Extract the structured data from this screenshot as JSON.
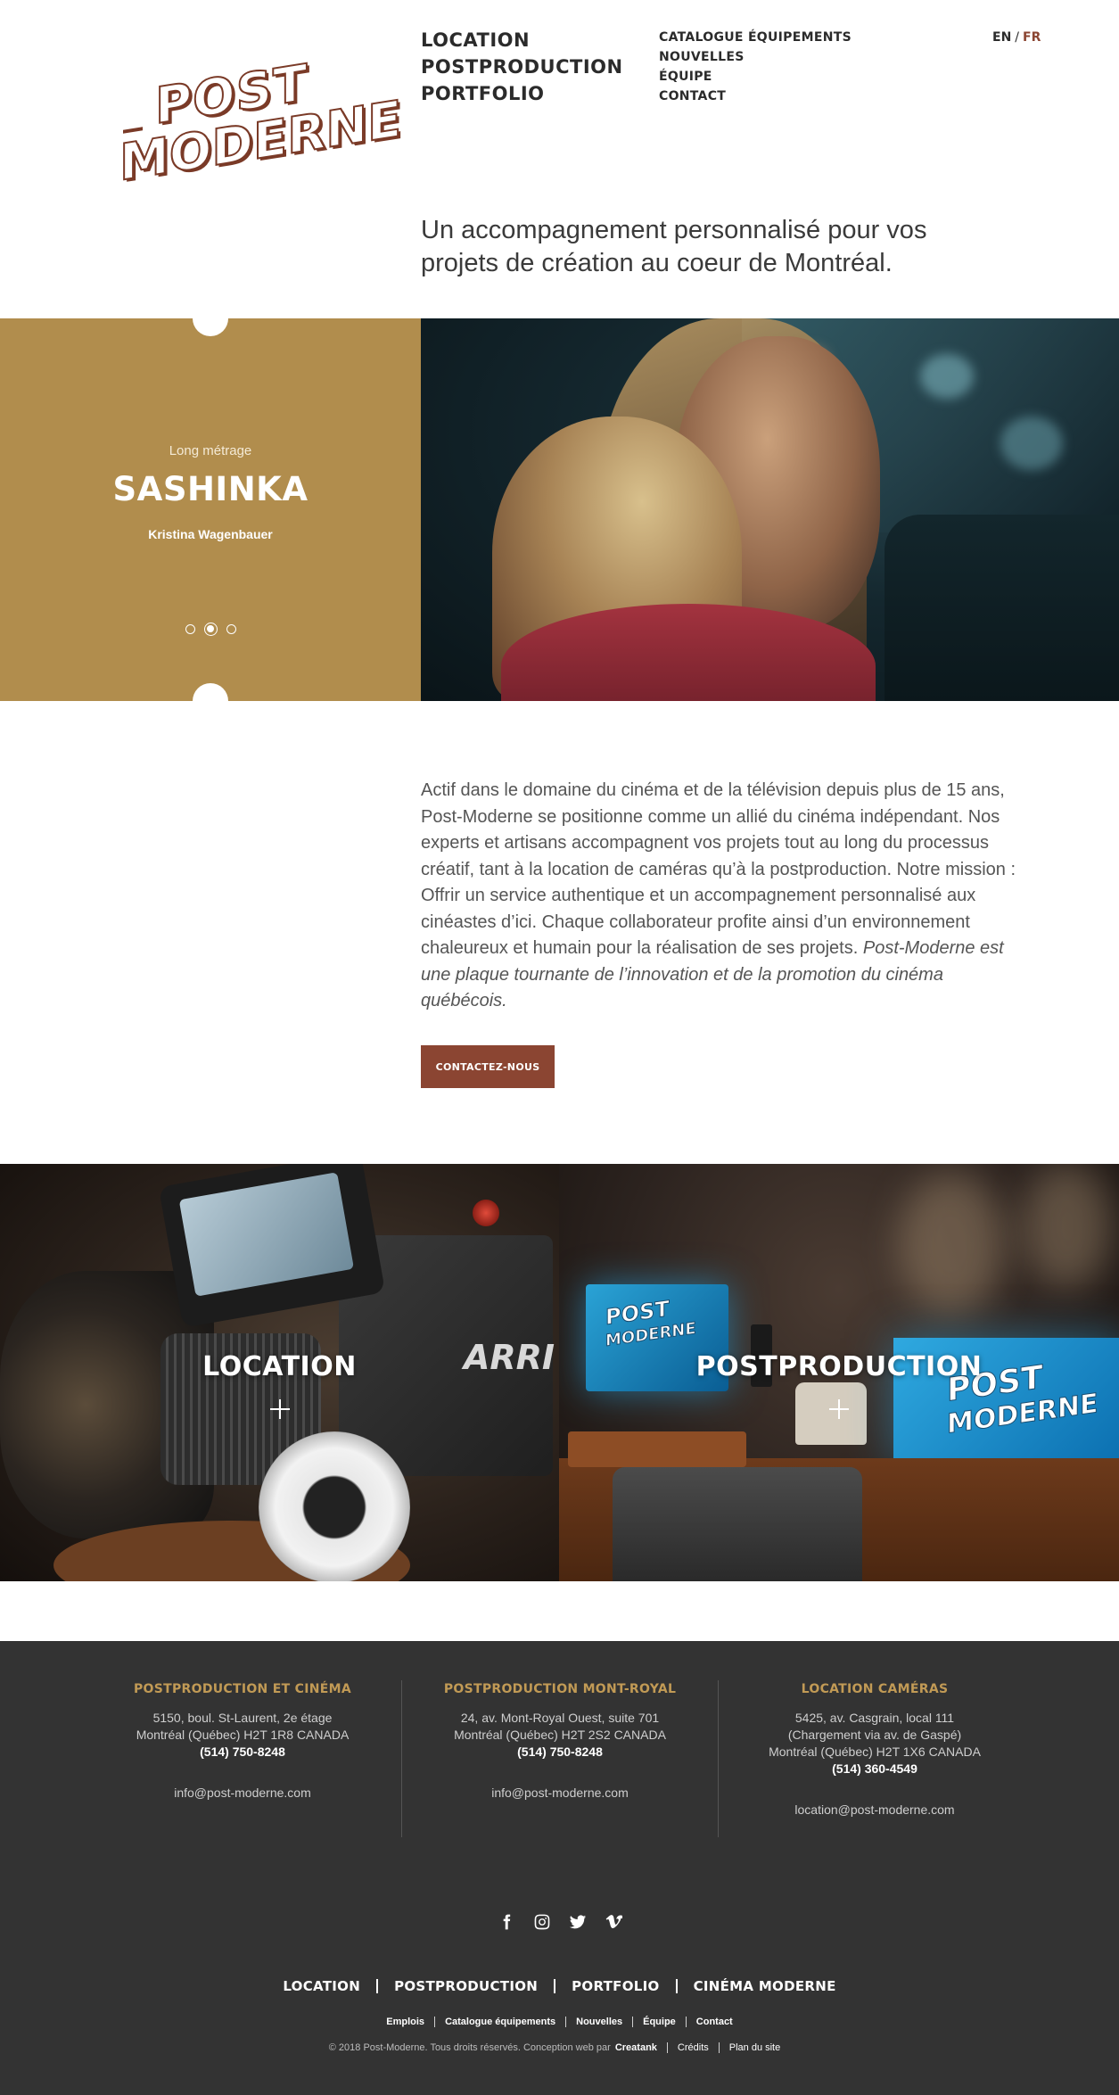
{
  "brand": {
    "logo_top": "POST",
    "logo_bottom": "MODERNE",
    "colors": {
      "rust": "#8b4532",
      "gold": "#b18d4d",
      "footer_bg": "#333333",
      "footer_title": "#c19a55"
    }
  },
  "header": {
    "main_nav": [
      "LOCATION",
      "POSTPRODUCTION",
      "PORTFOLIO"
    ],
    "sub_nav": [
      "CATALOGUE ÉQUIPEMENTS",
      "NOUVELLES",
      "ÉQUIPE",
      "CONTACT"
    ],
    "lang": {
      "en": "EN",
      "separator": "/",
      "fr": "FR",
      "active": "FR"
    }
  },
  "tagline": "Un accompagnement personnalisé pour vos projets de création au coeur de Montréal.",
  "hero": {
    "category": "Long métrage",
    "title": "SASHINKA",
    "author": "Kristina Wagenbauer",
    "slides_total": 3,
    "active_slide": 2
  },
  "about": {
    "text": "Actif dans le domaine du cinéma et de la télévision depuis plus de 15 ans, Post-Moderne se positionne comme un allié du cinéma indépendant. Nos experts et artisans accompagnent vos projets tout au long du processus créatif, tant à la location de caméras qu’à la postproduction. Notre mission : Offrir un service authentique et un accompagnement personnalisé aux cinéastes d’ici. Chaque collaborateur profite ainsi d’un environnement chaleureux et humain pour la réalisation de ses projets.",
    "emphasis": "Post-Moderne est une plaque tournante de l’innovation et de la promotion du cinéma québécois.",
    "cta": "CONTACTEZ-NOUS"
  },
  "services": [
    {
      "label": "LOCATION",
      "photo_text": "ARRI"
    },
    {
      "label": "POSTPRODUCTION",
      "photo_logo_top": "POST",
      "photo_logo_bottom": "MODERNE"
    }
  ],
  "footer": {
    "locations": [
      {
        "title": "POSTPRODUCTION ET CINÉMA",
        "lines": [
          "5150, boul. St-Laurent, 2e étage",
          "Montréal (Québec) H2T 1R8 CANADA"
        ],
        "phone": "(514) 750-8248",
        "email": "info@post-moderne.com"
      },
      {
        "title": "POSTPRODUCTION MONT-ROYAL",
        "lines": [
          "24, av. Mont-Royal Ouest, suite 701",
          "Montréal (Québec) H2T 2S2 CANADA"
        ],
        "phone": "(514) 750-8248",
        "email": "info@post-moderne.com"
      },
      {
        "title": "LOCATION CAMÉRAS",
        "lines": [
          "5425, av. Casgrain, local 111",
          "(Chargement via av. de Gaspé)",
          "Montréal (Québec) H2T 1X6 CANADA"
        ],
        "phone": "(514) 360-4549",
        "email": "location@post-moderne.com"
      }
    ],
    "socials": [
      "facebook-icon",
      "instagram-icon",
      "twitter-icon",
      "vimeo-icon"
    ],
    "nav": [
      "LOCATION",
      "POSTPRODUCTION",
      "PORTFOLIO",
      "CINÉMA MODERNE"
    ],
    "links": [
      "Emplois",
      "Catalogue équipements",
      "Nouvelles",
      "Équipe",
      "Contact"
    ],
    "copyright": "© 2018 Post-Moderne. Tous droits réservés. Conception web par",
    "agency": "Creatank",
    "legal": [
      "Crédits",
      "Plan du site"
    ]
  }
}
